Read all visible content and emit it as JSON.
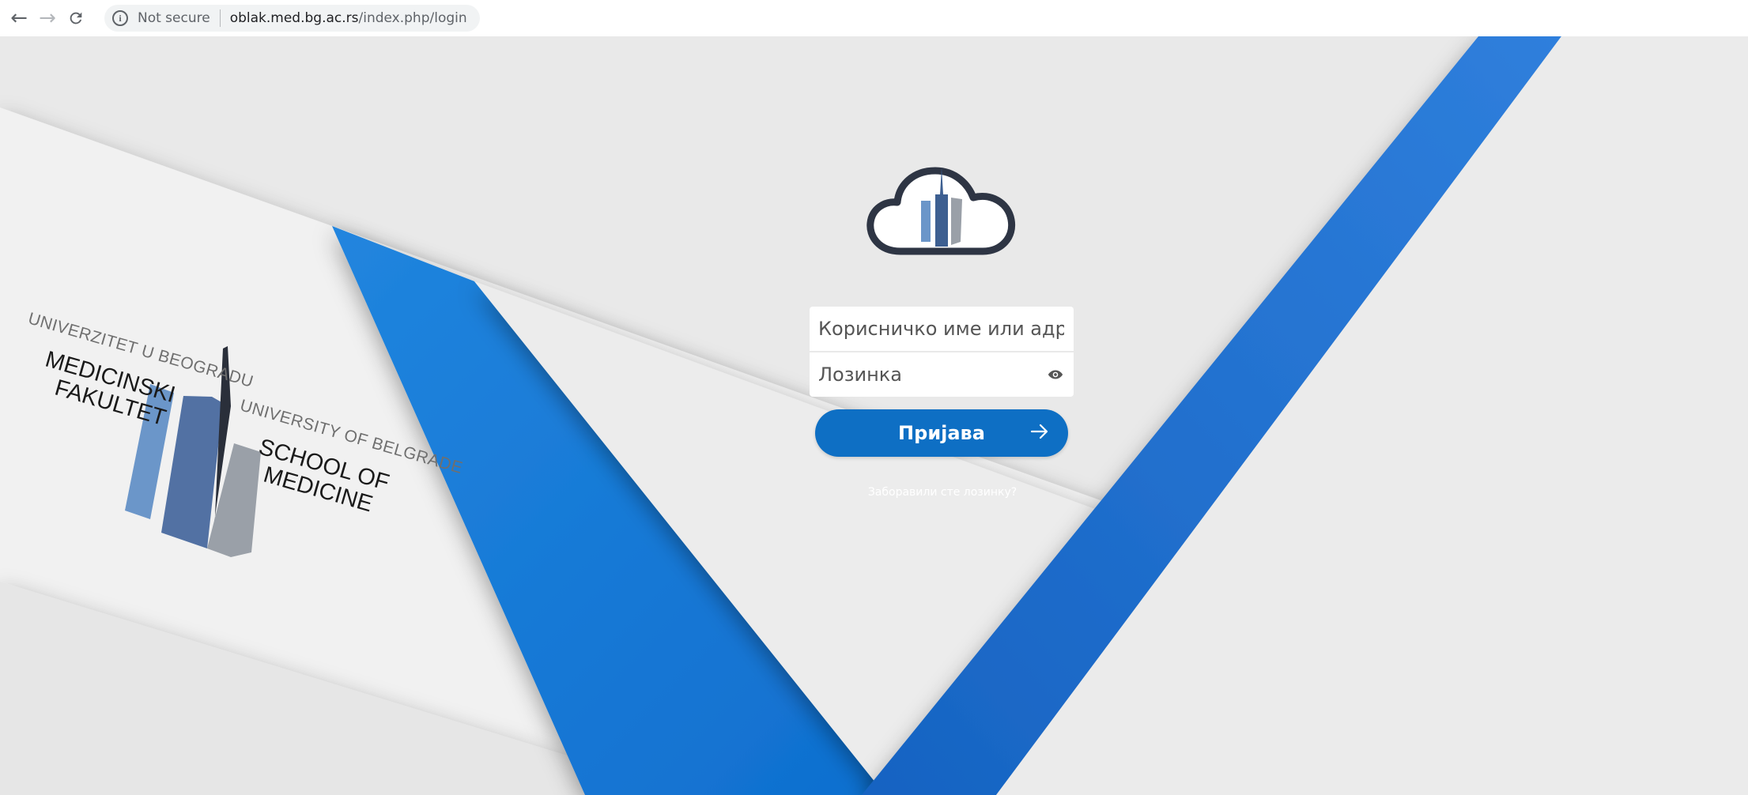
{
  "browser": {
    "security_label": "Not secure",
    "url_host": "oblak.med.bg.ac.rs",
    "url_path": "/index.php/login",
    "icons": [
      "back-arrow-icon",
      "forward-arrow-icon",
      "reload-icon",
      "info-icon"
    ]
  },
  "logo": {
    "univ_bg": "UNIVERZITET U BEOGRADU",
    "medicinski": "MEDICINSKI",
    "fakultet": "FAKULTET",
    "univ_en": "UNIVERSITY OF BELGRADE",
    "school": "SCHOOL OF",
    "medicine": "MEDICINE"
  },
  "login": {
    "username_placeholder": "Корисничко име или адреса е-поште",
    "password_placeholder": "Лозинка",
    "submit_label": "Пријава",
    "forgot_label": "Заборавили сте лозинку?"
  },
  "colors": {
    "accent": "#0e6fc4",
    "stripe_blue": "#1a80dc",
    "background": "#ebebeb"
  }
}
